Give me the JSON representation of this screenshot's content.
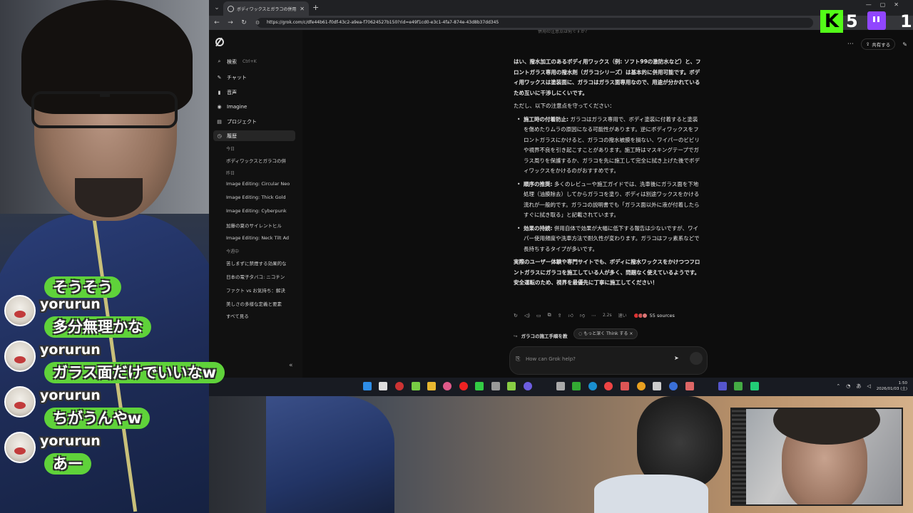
{
  "browser": {
    "tab_title": "ボディワックスとガラコの併用ガイド",
    "url": "https://grok.com/c/dfe44b61-f0df-43c2-a9ea-f70624527b150?rid=e49f1cd0-e3c1-4fa7-874e-43d8b37dd345"
  },
  "stream": {
    "kick_logo": "K",
    "kick_count": "5",
    "twitch_count": "1"
  },
  "sidebar": {
    "search_label": "検索",
    "search_shortcut": "Ctrl+K",
    "items": [
      {
        "label": "チャット",
        "icon": "chat-icon"
      },
      {
        "label": "音声",
        "icon": "voice-icon"
      },
      {
        "label": "Imagine",
        "icon": "imagine-icon"
      },
      {
        "label": "プロジェクト",
        "icon": "project-icon"
      },
      {
        "label": "履歴",
        "icon": "history-icon"
      }
    ],
    "groups": {
      "today": "今日",
      "yesterday": "昨日",
      "this_month": "今週中"
    },
    "history_today": [
      "ボディワックスとガラコの併"
    ],
    "history_yesterday": [
      "Image Editing: Circular Neo",
      "Image Editing: Thick Gold",
      "Image Editing: Cyberpunk",
      "加藤の夏のサイレントヒル",
      "Image Editing: Neck Tilt Ad"
    ],
    "history_week": [
      "苦しまずに禁煙する効果的な",
      "日本の電子タバコ: ニコチン",
      "ファクト vs お気持ち：解決",
      "美しさの多様な定義と要素"
    ],
    "see_all": "すべて見る"
  },
  "main": {
    "top_strip": "併用の注意点は何ですか？",
    "share_label": "共有する",
    "answer": {
      "intro": "はい、撥水加工のあるボディ用ワックス（例: ソフト99の激防水など）と、フロントガラス専用の撥水剤（ガラコシリーズ）は基本的に併用可能です。ボディ用ワックスは塗装面に、ガラコはガラス面専用なので、用途が分かれているため互いに干渉しにくいです。",
      "lead": "ただし、以下の注意点を守ってください：",
      "bullets": [
        {
          "title": "施工時の付着防止:",
          "text": " ガラコはガラス専用で、ボディ塗装に付着すると塗装を傷めたりムラの原因になる可能性があります。逆にボディワックスをフロントガラスにかけると、ガラコの撥水被膜を損ない、ワイパーのビビリや視界不良を引き起こすことがあります。施工時はマスキングテープでガラス周りを保護するか、ガラコを先に施工して完全に拭き上げた後でボディワックスをかけるのがおすすめです。"
        },
        {
          "title": "順序の推奨:",
          "text": " 多くのレビューや施工ガイドでは、洗車後にガラス面を下地処理（油膜除去）してからガラコを塗り、ボディは別途ワックスをかける流れが一般的です。ガラコの説明書でも「ガラス面以外に液が付着したらすぐに拭き取る」と記載されています。"
        },
        {
          "title": "効果の持続:",
          "text": " 併用自体で効果が大幅に低下する報告は少ないですが、ワイパー使用頻度や洗車方法で耐久性が変わります。ガラコはフッ素系などで長持ちするタイプが多いです。"
        }
      ],
      "conclusion": "実際のユーザー体験や専門サイトでも、ボディに撥水ワックスをかけつつフロントガラスにガラコを施工している人が多く、問題なく使えているようです。安全運転のため、視界を最優先に丁寧に施工してください！"
    },
    "meta_time": "2.2s",
    "meta_speed": "速い",
    "sources_label": "55 sources",
    "related": "ガラコの施工手順を教",
    "think_pill": "もっと深く Think する",
    "composer_placeholder": "How can Grok help?"
  },
  "chat": {
    "messages": [
      {
        "user": "",
        "text": "そうそう"
      },
      {
        "user": "yorurun",
        "text": "多分無理かな"
      },
      {
        "user": "yorurun",
        "text": "ガラス面だけでいいなw"
      },
      {
        "user": "yorurun",
        "text": "ちがうんやw"
      },
      {
        "user": "yorurun",
        "text": "あー"
      }
    ]
  },
  "taskbar": {
    "time": "1:50",
    "date": "2026/01/03 (土)",
    "lang": "あ"
  },
  "colors": {
    "chat_bubble": "#5fd23a",
    "kick_green": "#53fc18",
    "twitch_purple": "#9146ff",
    "grok_bg": "#0d0d0d"
  }
}
